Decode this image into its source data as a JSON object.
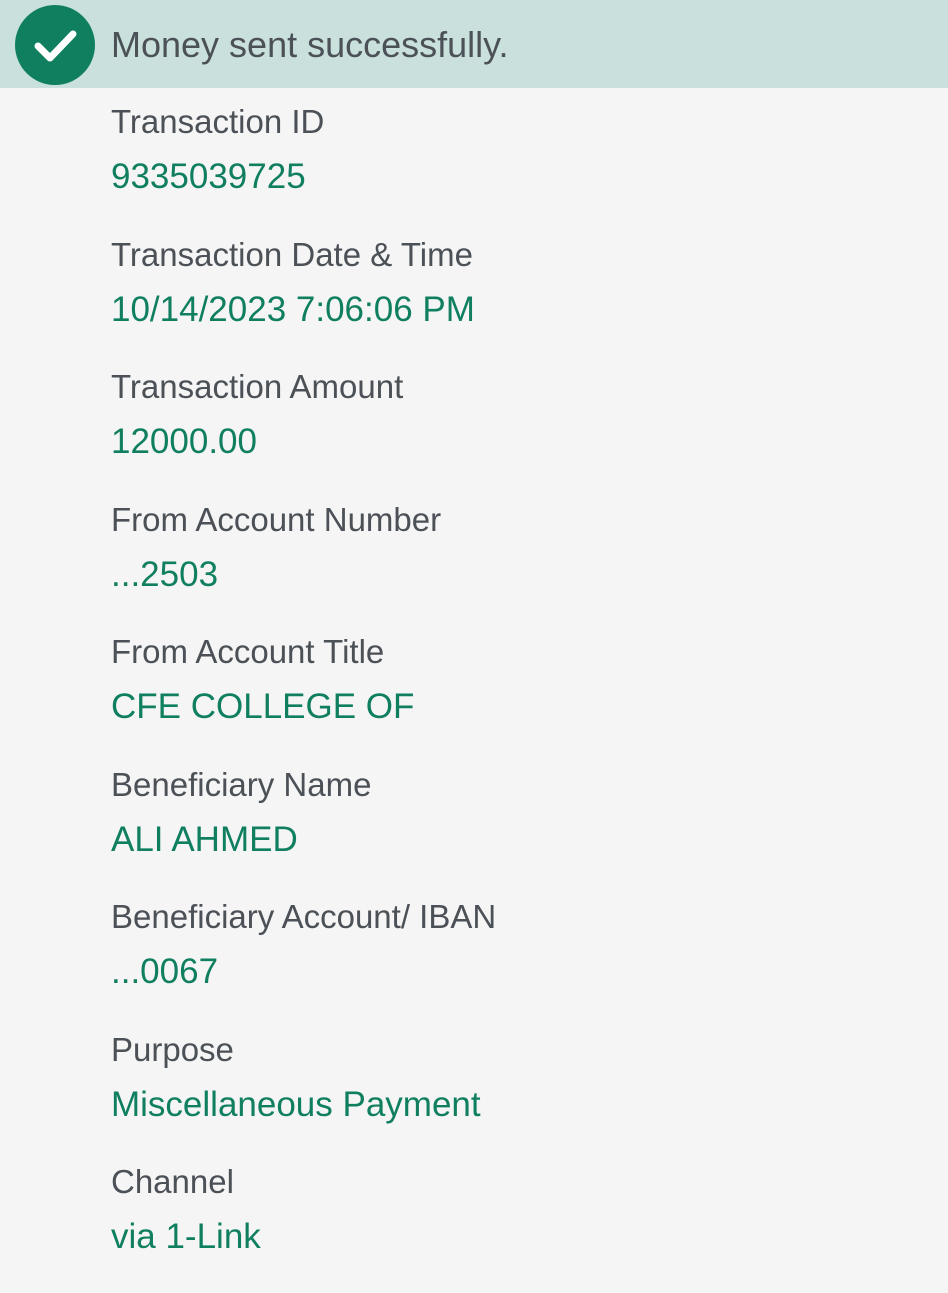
{
  "banner": {
    "icon": "check-circle-icon",
    "message": "Money sent successfully."
  },
  "colors": {
    "accent": "#0f7f60",
    "label": "#4b5157",
    "banner_bg": "#c9e0dc",
    "page_bg": "#f5f5f5"
  },
  "fields": [
    {
      "label": "Transaction ID",
      "value": "9335039725"
    },
    {
      "label": "Transaction Date & Time",
      "value": "10/14/2023 7:06:06 PM"
    },
    {
      "label": "Transaction Amount",
      "value": "12000.00"
    },
    {
      "label": "From Account Number",
      "value": "...2503"
    },
    {
      "label": "From Account Title",
      "value": "CFE COLLEGE OF"
    },
    {
      "label": "Beneficiary Name",
      "value": "ALI AHMED"
    },
    {
      "label": "Beneficiary Account/ IBAN",
      "value": "...0067"
    },
    {
      "label": "Purpose",
      "value": "Miscellaneous Payment"
    },
    {
      "label": "Channel",
      "value": "via 1-Link"
    }
  ]
}
